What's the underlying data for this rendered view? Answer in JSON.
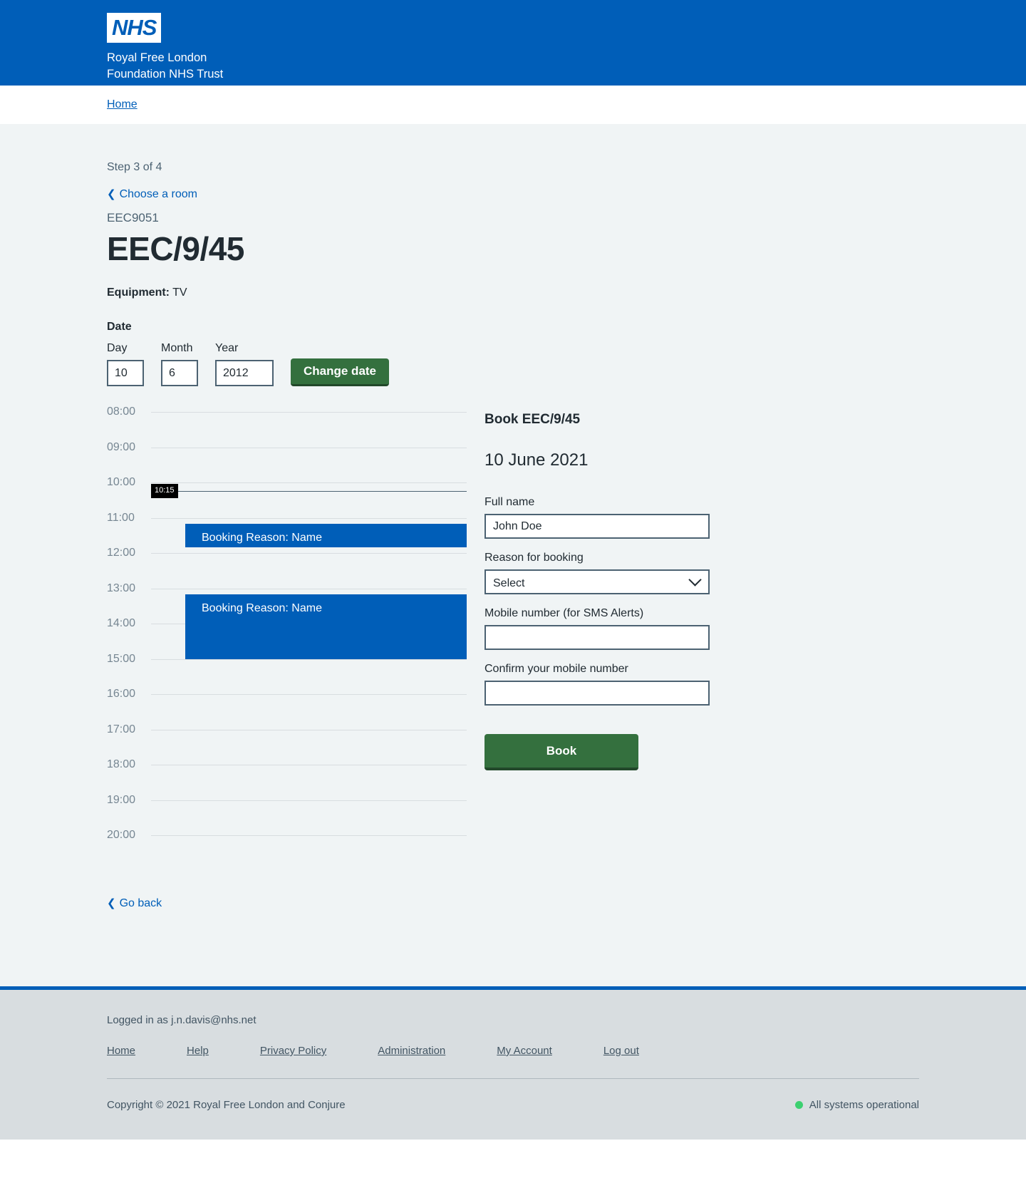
{
  "header": {
    "logo_text": "NHS",
    "trust_line1": "Royal Free London",
    "trust_line2": "Foundation NHS Trust"
  },
  "breadcrumb": {
    "home_label": "Home"
  },
  "page": {
    "step_text": "Step 3 of 4",
    "back_label": "Choose a room",
    "room_code": "EEC9051",
    "room_title": "EEC/9/45",
    "equipment_label": "Equipment:",
    "equipment_value": "TV",
    "date_group_label": "Date",
    "day_label": "Day",
    "day_value": "10",
    "month_label": "Month",
    "month_value": "6",
    "year_label": "Year",
    "year_value": "2012",
    "change_date_label": "Change date",
    "go_back_label": "Go back"
  },
  "timeline": {
    "slots": [
      "08:00",
      "09:00",
      "10:00",
      "11:00",
      "12:00",
      "13:00",
      "14:00",
      "15:00",
      "16:00",
      "17:00",
      "18:00",
      "19:00",
      "20:00"
    ],
    "current_time_marker": "10:15",
    "bookings": [
      {
        "label": "Booking Reason: Name",
        "start": "11:10",
        "end": "11:50"
      },
      {
        "label": "Booking Reason: Name",
        "start": "13:10",
        "end": "15:00"
      }
    ]
  },
  "booking_form": {
    "title": "Book EEC/9/45",
    "date": "10 June 2021",
    "full_name_label": "Full name",
    "full_name_value": "John Doe",
    "reason_label": "Reason for booking",
    "reason_value": "Select",
    "mobile_label": "Mobile number (for SMS Alerts)",
    "mobile_value": "",
    "confirm_mobile_label": "Confirm your mobile number",
    "confirm_mobile_value": "",
    "submit_label": "Book"
  },
  "footer": {
    "logged_in": "Logged in as j.n.davis@nhs.net",
    "links": [
      "Home",
      "Help",
      "Privacy Policy",
      "Administration",
      "My Account",
      "Log out"
    ],
    "copyright": "Copyright © 2021 Royal Free London and Conjure",
    "status_text": "All systems operational",
    "status_color": "#3cd070"
  },
  "colors": {
    "nhs_blue": "#005eb8",
    "green": "#34703e",
    "booking_blue": "#005eb8",
    "page_bg": "#f0f4f5",
    "footer_bg": "#d8dde0"
  }
}
